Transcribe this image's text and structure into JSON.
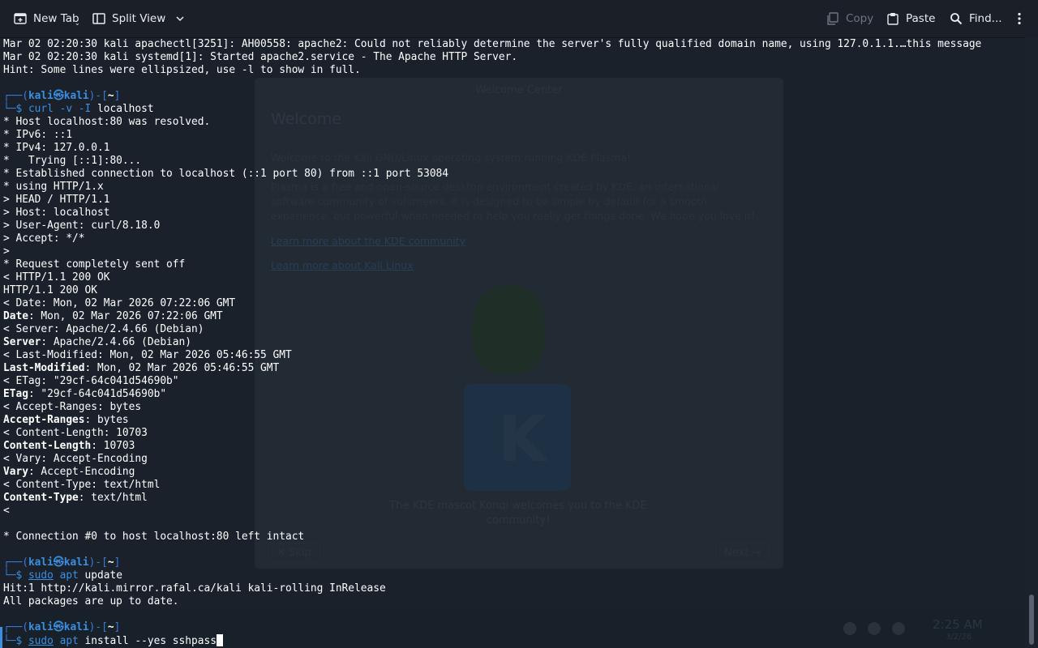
{
  "toolbar": {
    "new_tab": "New Tab",
    "split_view": "Split View",
    "copy": "Copy",
    "paste": "Paste",
    "find": "Find..."
  },
  "terminal": {
    "prompt": {
      "user": "kali",
      "host": "kali",
      "separator": "㉿",
      "dir": "~"
    },
    "lines": [
      {
        "segs": [
          {
            "t": "Mar 02 02:20:30 kali apachectl[3251]: AH00558: apache2: Could not reliably determine the server's fully qualified domain name, using 127.0.1.1.…this message"
          }
        ]
      },
      {
        "segs": [
          {
            "t": "Mar 02 02:20:30 kali systemd[1]: Started apache2.service - The Apache HTTP Server."
          }
        ]
      },
      {
        "segs": [
          {
            "t": "Hint: Some lines were ellipsized, use -l to show in full."
          }
        ]
      },
      {
        "segs": []
      },
      {
        "type": "prompt-top"
      },
      {
        "type": "prompt-cmd",
        "segs": [
          {
            "t": "curl",
            "c": "cmd"
          },
          {
            "t": " "
          },
          {
            "t": "-v -I",
            "c": "cmd"
          },
          {
            "t": " localhost"
          }
        ]
      },
      {
        "segs": [
          {
            "t": "* Host localhost:80 was resolved."
          }
        ]
      },
      {
        "segs": [
          {
            "t": "* IPv6: ::1"
          }
        ]
      },
      {
        "segs": [
          {
            "t": "* IPv4: 127.0.0.1"
          }
        ]
      },
      {
        "segs": [
          {
            "t": "*   Trying [::1]:80..."
          }
        ]
      },
      {
        "segs": [
          {
            "t": "* Established connection to localhost (::1 port 80) from ::1 port 53084"
          }
        ]
      },
      {
        "segs": [
          {
            "t": "* using HTTP/1.x"
          }
        ]
      },
      {
        "segs": [
          {
            "t": "> HEAD / HTTP/1.1"
          }
        ]
      },
      {
        "segs": [
          {
            "t": "> Host: localhost"
          }
        ]
      },
      {
        "segs": [
          {
            "t": "> User-Agent: curl/8.18.0"
          }
        ]
      },
      {
        "segs": [
          {
            "t": "> Accept: */*"
          }
        ]
      },
      {
        "segs": [
          {
            "t": ">"
          }
        ]
      },
      {
        "segs": [
          {
            "t": "* Request completely sent off"
          }
        ]
      },
      {
        "segs": [
          {
            "t": "< HTTP/1.1 200 OK"
          }
        ]
      },
      {
        "segs": [
          {
            "t": "HTTP/1.1 200 OK"
          }
        ]
      },
      {
        "segs": [
          {
            "t": "< Date: Mon, 02 Mar 2026 07:22:06 GMT"
          }
        ]
      },
      {
        "segs": [
          {
            "t": "Date",
            "c": "hdr"
          },
          {
            "t": ": Mon, 02 Mar 2026 07:22:06 GMT"
          }
        ]
      },
      {
        "segs": [
          {
            "t": "< Server: Apache/2.4.66 (Debian)"
          }
        ]
      },
      {
        "segs": [
          {
            "t": "Server",
            "c": "hdr"
          },
          {
            "t": ": Apache/2.4.66 (Debian)"
          }
        ]
      },
      {
        "segs": [
          {
            "t": "< Last-Modified: Mon, 02 Mar 2026 05:46:55 GMT"
          }
        ]
      },
      {
        "segs": [
          {
            "t": "Last-Modified",
            "c": "hdr"
          },
          {
            "t": ": Mon, 02 Mar 2026 05:46:55 GMT"
          }
        ]
      },
      {
        "segs": [
          {
            "t": "< ETag: \"29cf-64c041d54690b\""
          }
        ]
      },
      {
        "segs": [
          {
            "t": "ETag",
            "c": "hdr"
          },
          {
            "t": ": \"29cf-64c041d54690b\""
          }
        ]
      },
      {
        "segs": [
          {
            "t": "< Accept-Ranges: bytes"
          }
        ]
      },
      {
        "segs": [
          {
            "t": "Accept-Ranges",
            "c": "hdr"
          },
          {
            "t": ": bytes"
          }
        ]
      },
      {
        "segs": [
          {
            "t": "< Content-Length: 10703"
          }
        ]
      },
      {
        "segs": [
          {
            "t": "Content-Length",
            "c": "hdr"
          },
          {
            "t": ": 10703"
          }
        ]
      },
      {
        "segs": [
          {
            "t": "< Vary: Accept-Encoding"
          }
        ]
      },
      {
        "segs": [
          {
            "t": "Vary",
            "c": "hdr"
          },
          {
            "t": ": Accept-Encoding"
          }
        ]
      },
      {
        "segs": [
          {
            "t": "< Content-Type: text/html"
          }
        ]
      },
      {
        "segs": [
          {
            "t": "Content-Type",
            "c": "hdr"
          },
          {
            "t": ": text/html"
          }
        ]
      },
      {
        "segs": [
          {
            "t": "<"
          }
        ]
      },
      {
        "segs": []
      },
      {
        "segs": [
          {
            "t": "* Connection #0 to host localhost:80 left intact"
          }
        ]
      },
      {
        "segs": []
      },
      {
        "type": "prompt-top"
      },
      {
        "type": "prompt-cmd",
        "segs": [
          {
            "t": "sudo",
            "c": "sudo"
          },
          {
            "t": " "
          },
          {
            "t": "apt",
            "c": "cmd"
          },
          {
            "t": " update"
          }
        ]
      },
      {
        "segs": [
          {
            "t": "Hit:1 http://kali.mirror.rafal.ca/kali kali-rolling InRelease"
          }
        ]
      },
      {
        "segs": [
          {
            "t": "All packages are up to date."
          }
        ]
      },
      {
        "segs": []
      },
      {
        "type": "prompt-top"
      },
      {
        "type": "prompt-cmd",
        "cursor": true,
        "segs": [
          {
            "t": "sudo",
            "c": "sudo"
          },
          {
            "t": " "
          },
          {
            "t": "apt",
            "c": "cmd"
          },
          {
            "t": " install --yes sshpass"
          }
        ]
      }
    ]
  },
  "background": {
    "dialog_title": "Welcome Center",
    "heading": "Welcome",
    "para1": "Welcome to the Kali GNU/Linux operating system running KDE Plasma!",
    "para2": "Plasma is a free and open-source desktop environment created by KDE, an international software community of volunteers. It is designed to be simple by default for a smooth experience, but powerful when needed to help you really get things done. We hope you love it!",
    "link1": "Learn more about the KDE community",
    "link2": "Learn more about Kali Linux",
    "caption": "The KDE mascot Konqi welcomes you to the KDE community!",
    "skip": "✕ Skip",
    "next": "Next →",
    "clock": "2:25 AM",
    "date": "3/2/26"
  }
}
